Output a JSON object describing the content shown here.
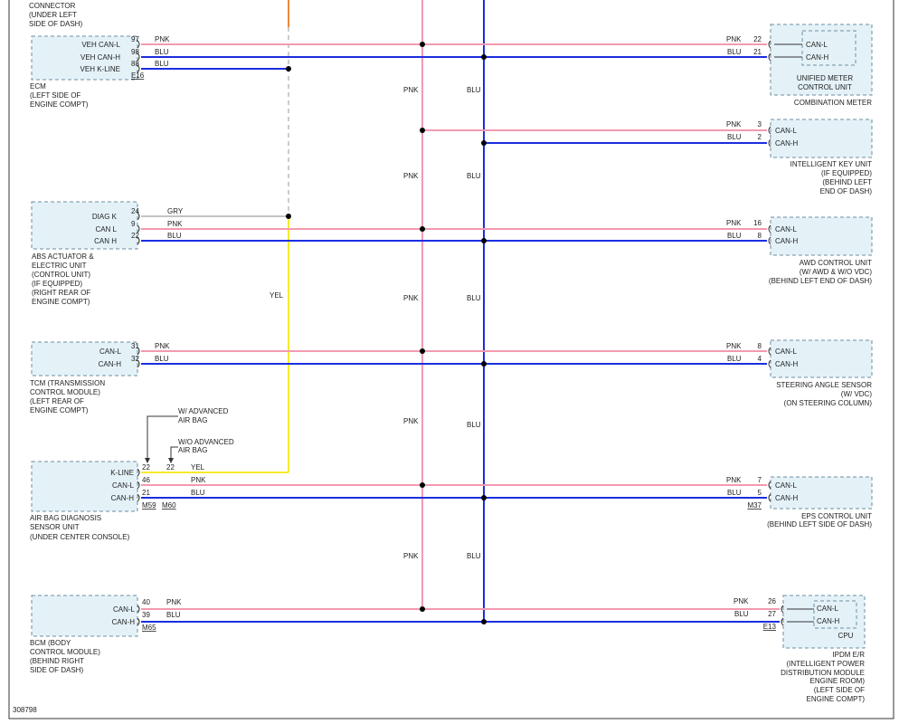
{
  "drawing_id": "308798",
  "colors": {
    "pnk": "#f29ab0",
    "blu": "#1a2ee0",
    "yel": "#f7ea2a",
    "org": "#f0883a",
    "gry": "#b0b0b0",
    "box_fill": "#e4f2f8"
  },
  "wire_labels": {
    "pnk": "PNK",
    "blu": "BLU",
    "yel": "YEL",
    "gry": "GRY"
  },
  "connector_top": {
    "l1": "CONNECTOR",
    "l2": "(UNDER LEFT",
    "l3": "SIDE OF DASH)"
  },
  "ecm": {
    "pins": [
      {
        "label": "VEH CAN-L",
        "num": "97",
        "color": "PNK"
      },
      {
        "label": "VEH CAN-H",
        "num": "98",
        "color": "BLU"
      },
      {
        "label": "VEH K-LINE",
        "num": "88",
        "color": "BLU"
      }
    ],
    "conn": "E16",
    "name": {
      "l1": "ECM",
      "l2": "(LEFT SIDE OF",
      "l3": "ENGINE COMPT)"
    }
  },
  "abs": {
    "pins": [
      {
        "label": "DIAG K",
        "num": "24",
        "color": "GRY"
      },
      {
        "label": "CAN L",
        "num": "9",
        "color": "PNK"
      },
      {
        "label": "CAN H",
        "num": "22",
        "color": "BLU"
      }
    ],
    "name": {
      "l1": "ABS ACTUATOR &",
      "l2": "ELECTRIC UNIT",
      "l3": "(CONTROL UNIT)",
      "l4": "(IF EQUIPPED)",
      "l5": "(RIGHT REAR OF",
      "l6": "ENGINE COMPT)"
    }
  },
  "tcm": {
    "pins": [
      {
        "label": "CAN-L",
        "num": "31",
        "color": "PNK"
      },
      {
        "label": "CAN-H",
        "num": "32",
        "color": "BLU"
      }
    ],
    "name": {
      "l1": "TCM (TRANSMISSION",
      "l2": "CONTROL MODULE)",
      "l3": "(LEFT REAR OF",
      "l4": "ENGINE COMPT)"
    }
  },
  "airbag": {
    "note1": {
      "l1": "W/ ADVANCED",
      "l2": "AIR BAG"
    },
    "note2": {
      "l1": "W/O ADVANCED",
      "l2": "AIR BAG"
    },
    "kline_nums": {
      "a": "22",
      "b": "22"
    },
    "pins": [
      {
        "label": "K-LINE",
        "color": "YEL"
      },
      {
        "label": "CAN-L",
        "num": "46",
        "color": "PNK"
      },
      {
        "label": "CAN-H",
        "num": "21",
        "color": "BLU"
      }
    ],
    "conn1": "M59",
    "conn2": "M60",
    "name": {
      "l1": "AIR BAG DIAGNOSIS",
      "l2": "SENSOR UNIT",
      "l3": "(UNDER CENTER CONSOLE)"
    }
  },
  "bcm": {
    "pins": [
      {
        "label": "CAN-L",
        "num": "40",
        "color": "PNK"
      },
      {
        "label": "CAN-H",
        "num": "39",
        "color": "BLU"
      }
    ],
    "conn": "M65",
    "name": {
      "l1": "BCM (BODY",
      "l2": "CONTROL MODULE)",
      "l3": "(BEHIND RIGHT",
      "l4": "SIDE OF DASH)"
    }
  },
  "meter": {
    "pins": [
      {
        "label": "CAN-L",
        "num": "22",
        "color": "PNK"
      },
      {
        "label": "CAN-H",
        "num": "21",
        "color": "BLU"
      }
    ],
    "inner": {
      "l1": "UNIFIED METER",
      "l2": "CONTROL UNIT"
    },
    "name": {
      "l1": "COMBINATION METER"
    }
  },
  "keyunit": {
    "pins": [
      {
        "label": "CAN-L",
        "num": "3",
        "color": "PNK"
      },
      {
        "label": "CAN-H",
        "num": "2",
        "color": "BLU"
      }
    ],
    "name": {
      "l1": "INTELLIGENT KEY UNIT",
      "l2": "(IF EQUIPPED)",
      "l3": "(BEHIND LEFT",
      "l4": "END OF DASH)"
    }
  },
  "awd": {
    "pins": [
      {
        "label": "CAN-L",
        "num": "16",
        "color": "PNK"
      },
      {
        "label": "CAN-H",
        "num": "8",
        "color": "BLU"
      }
    ],
    "name": {
      "l1": "AWD CONTROL UNIT",
      "l2": "(W/ AWD & W/O VDC)",
      "l3": "(BEHIND LEFT END OF DASH)"
    }
  },
  "steering": {
    "pins": [
      {
        "label": "CAN-L",
        "num": "8",
        "color": "PNK"
      },
      {
        "label": "CAN-H",
        "num": "4",
        "color": "BLU"
      }
    ],
    "name": {
      "l1": "STEERING ANGLE SENSOR",
      "l2": "(W/ VDC)",
      "l3": "(ON STEERING COLUMN)"
    }
  },
  "eps": {
    "pins": [
      {
        "label": "CAN-L",
        "num": "7",
        "color": "PNK"
      },
      {
        "label": "CAN-H",
        "num": "5",
        "color": "BLU"
      }
    ],
    "conn": "M37",
    "name": {
      "l1": "EPS CONTROL UNIT",
      "l2": "(BEHIND LEFT SIDE OF DASH)"
    }
  },
  "ipdm": {
    "pins": [
      {
        "label": "CAN-L",
        "num": "26",
        "color": "PNK"
      },
      {
        "label": "CAN-H",
        "num": "27",
        "color": "BLU"
      }
    ],
    "conn": "E13",
    "inner": {
      "l1": "CPU"
    },
    "name": {
      "l1": "IPDM E/R",
      "l2": "(INTELLIGENT POWER",
      "l3": "DISTRIBUTION MODULE",
      "l4": "ENGINE ROOM)",
      "l5": "(LEFT SIDE OF",
      "l6": "ENGINE COMPT)"
    }
  }
}
